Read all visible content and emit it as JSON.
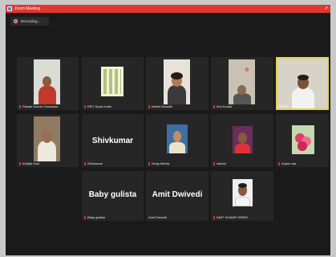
{
  "titlebar": {
    "title": "Zoom Meeting",
    "right_glyph": "↗"
  },
  "recording": {
    "label": "Recording..."
  },
  "participants": [
    {
      "name": "Pawan Kumar Chaurasia"
    },
    {
      "name": "ERC Sparc India"
    },
    {
      "name": "Neeta Kaushik"
    },
    {
      "name": "Anil Kumar"
    },
    {
      "name": "SPARC"
    },
    {
      "name": "Khatija Kazi"
    },
    {
      "name": "Shivkumar",
      "display": "Shivkumar"
    },
    {
      "name": "Vinay Mehta"
    },
    {
      "name": "rakesh"
    },
    {
      "name": "Anjum ara"
    },
    {
      "name": "Baby gulista",
      "display": "Baby gulista"
    },
    {
      "name": "Amit Dwivedi",
      "display": "Amit Dwivedi"
    },
    {
      "name": "AMIT KUMAR SPARC"
    }
  ],
  "colors": {
    "titlebar": "#e0372f",
    "active_border": "#e8d24a",
    "tile": "#262626"
  }
}
